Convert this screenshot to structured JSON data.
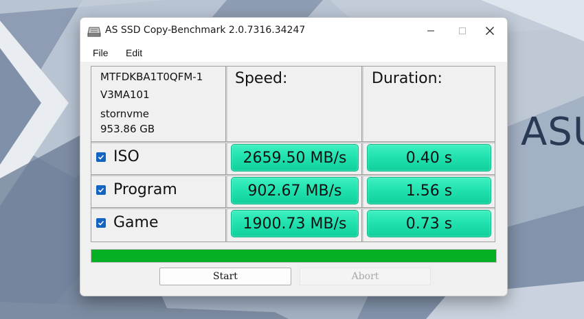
{
  "window": {
    "title": "AS SSD Copy-Benchmark 2.0.7316.34247"
  },
  "menu": {
    "file": "File",
    "edit": "Edit"
  },
  "desktop": {
    "brand_text": "ASU"
  },
  "drive_info": {
    "model": "MTFDKBA1T0QFM-1",
    "firmware": "V3MA101",
    "driver": "stornvme",
    "size": "953.86 GB"
  },
  "columns": {
    "speed": "Speed:",
    "duration": "Duration:"
  },
  "rows": [
    {
      "label": "ISO",
      "checked": true,
      "speed": "2659.50 MB/s",
      "duration": "0.40 s"
    },
    {
      "label": "Program",
      "checked": true,
      "speed": "902.67 MB/s",
      "duration": "1.56 s"
    },
    {
      "label": "Game",
      "checked": true,
      "speed": "1900.73 MB/s",
      "duration": "0.73 s"
    }
  ],
  "progress": {
    "value_percent": 100
  },
  "buttons": {
    "start": "Start",
    "abort": "Abort"
  },
  "colors": {
    "result_cell": "#22e3b0",
    "progress": "#06b025",
    "checkbox": "#1565c0"
  }
}
